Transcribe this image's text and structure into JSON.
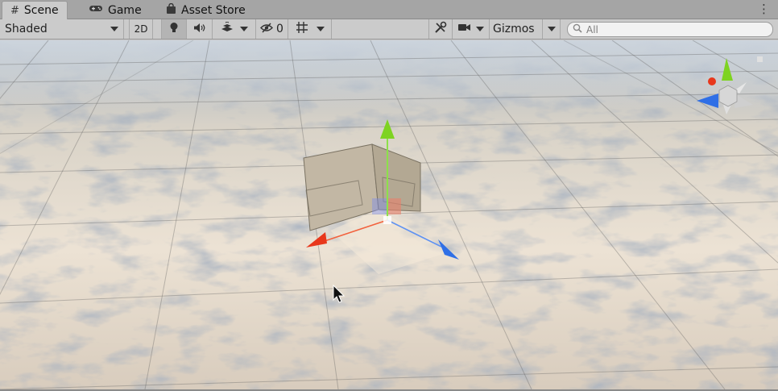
{
  "tabs": [
    {
      "label": "Scene",
      "icon": "hash-icon",
      "active": true
    },
    {
      "label": "Game",
      "icon": "gamepad-icon",
      "active": false
    },
    {
      "label": "Asset Store",
      "icon": "bag-icon",
      "active": false
    }
  ],
  "toolbar": {
    "draw_mode": "Shaded",
    "mode_2d": "2D",
    "hidden_count": "0",
    "gizmos_label": "Gizmos",
    "search_placeholder": "All"
  },
  "colors": {
    "x_axis": "#e8371b",
    "y_axis": "#7ed321",
    "z_axis": "#2f6fe6",
    "sky_light": "#f1e9df",
    "sky_shadow": "#6d7a8e"
  }
}
